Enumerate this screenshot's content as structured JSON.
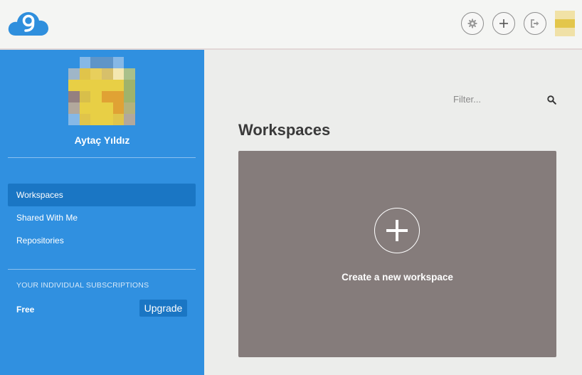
{
  "header": {
    "logo_icon": "cloud9-logo-icon",
    "actions": [
      {
        "name": "settings",
        "icon": "gear-icon"
      },
      {
        "name": "add",
        "icon": "plus-icon"
      },
      {
        "name": "logout",
        "icon": "sign-out-icon"
      }
    ]
  },
  "sidebar": {
    "user_name": "Aytaç Yıldız",
    "nav": [
      {
        "label": "Workspaces",
        "active": true
      },
      {
        "label": "Shared With Me",
        "active": false
      },
      {
        "label": "Repositories",
        "active": false
      }
    ],
    "subscriptions_heading": "YOUR INDIVIDUAL SUBSCRIPTIONS",
    "plan": "Free",
    "upgrade_label": "Upgrade"
  },
  "main": {
    "filter_placeholder": "Filter...",
    "title": "Workspaces",
    "create_label": "Create a new workspace"
  },
  "colors": {
    "sidebar": "#3090e0",
    "sidebar_active": "#1a76c4",
    "card": "#857c7b",
    "header": "#f4f5f3",
    "main_bg": "#ecedeb"
  }
}
